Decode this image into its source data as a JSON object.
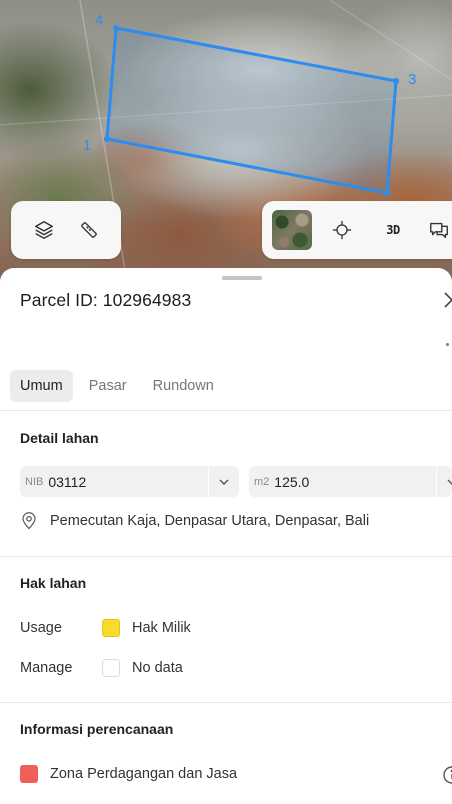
{
  "map": {
    "vertex_labels": [
      "4",
      "3",
      "1"
    ],
    "polygon_color": "#2d8cf0",
    "controls": {
      "layers_icon": "layers-icon",
      "measure_icon": "ruler-icon",
      "basemap_icon": "satellite-thumbnail",
      "locate_icon": "crosshair-icon",
      "three_d_label": "3D",
      "feedback_icon": "chat-icon"
    }
  },
  "sheet": {
    "title": "Parcel ID: 102964983",
    "tabs": [
      {
        "label": "Umum",
        "active": true
      },
      {
        "label": "Pasar",
        "active": false
      },
      {
        "label": "Rundown",
        "active": false
      }
    ],
    "detail": {
      "heading": "Detail lahan",
      "nib_prefix": "NIB",
      "nib_value": "03112",
      "area_prefix": "m2",
      "area_value": "125.0",
      "address": "Pemecutan Kaja, Denpasar Utara, Denpasar, Bali"
    },
    "hak": {
      "heading": "Hak lahan",
      "usage_label": "Usage",
      "usage_value": "Hak Milik",
      "usage_color": "#f8dc2c",
      "manage_label": "Manage",
      "manage_value": "No data",
      "manage_color": "#ffffff"
    },
    "planning": {
      "heading": "Informasi perencanaan",
      "zone_label": "Zona Perdagangan dan Jasa",
      "zone_color": "#f0605a"
    }
  }
}
